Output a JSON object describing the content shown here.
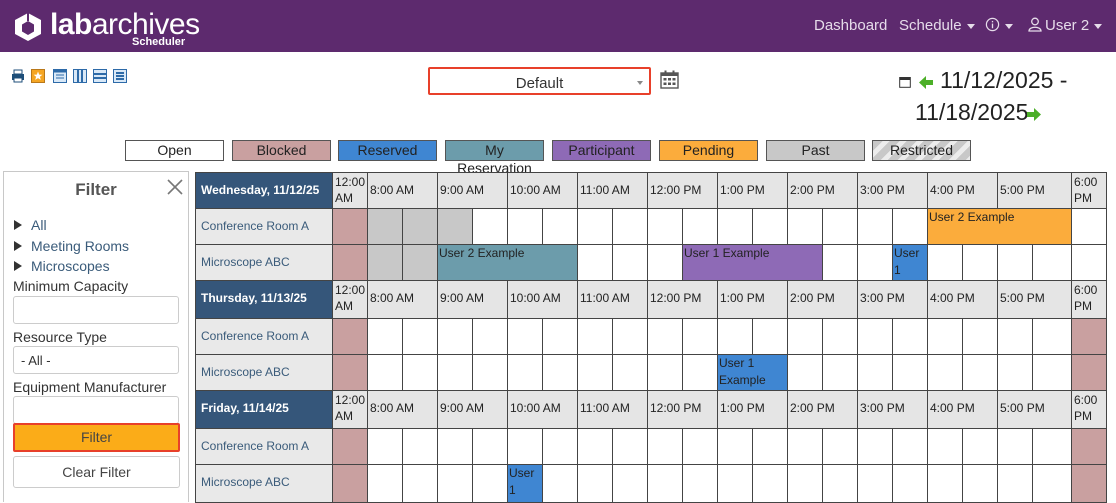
{
  "brand": {
    "name_bold": "lab",
    "name_rest": "archives",
    "subtitle": "Scheduler"
  },
  "nav": {
    "dashboard": "Dashboard",
    "schedule": "Schedule",
    "user": "User 2",
    "icons": [
      "info-icon",
      "user-icon"
    ]
  },
  "toolbar": {
    "icons": [
      "print-icon",
      "favorite-icon",
      "day-view-icon",
      "week-view-icon",
      "month-view-icon",
      "list-view-icon"
    ]
  },
  "view_select": {
    "value": "Default"
  },
  "date_range": {
    "line1": "11/12/2025 -",
    "line2": "11/18/2025"
  },
  "legend": [
    {
      "label": "Open",
      "color": "#ffffff"
    },
    {
      "label": "Blocked",
      "color": "#c9a0a0"
    },
    {
      "label": "Reserved",
      "color": "#3f86d2"
    },
    {
      "label": "My Reservation",
      "color": "#6c9cab"
    },
    {
      "label": "Participant",
      "color": "#8e6ab6"
    },
    {
      "label": "Pending",
      "color": "#fbac3c"
    },
    {
      "label": "Past",
      "color": "#c8c8c8"
    },
    {
      "label": "Restricted",
      "color": "#cfcfcf"
    }
  ],
  "filter": {
    "title": "Filter",
    "tree": [
      "All",
      "Meeting Rooms",
      "Microscopes"
    ],
    "min_capacity_label": "Minimum Capacity",
    "min_capacity_value": "",
    "resource_type_label": "Resource Type",
    "resource_type_value": "- All -",
    "manufacturer_label": "Equipment Manufacturer",
    "manufacturer_value": "",
    "filter_button": "Filter",
    "clear_button": "Clear Filter"
  },
  "times": [
    "12:00 AM",
    "8:00 AM",
    "9:00 AM",
    "10:00 AM",
    "11:00 AM",
    "12:00 PM",
    "1:00 PM",
    "2:00 PM",
    "3:00 PM",
    "4:00 PM",
    "5:00 PM",
    "6:00 PM"
  ],
  "days": [
    {
      "label": "Wednesday, 11/12/25",
      "resources": [
        {
          "name": "Conference Room A",
          "slots": [
            "blocked",
            "past",
            "past",
            "past",
            "",
            "",
            "",
            "",
            "",
            "",
            "",
            "",
            "",
            "",
            "",
            "",
            "",
            "",
            "",
            "",
            "",
            ""
          ]
        },
        {
          "name": "Microscope ABC",
          "slots": [
            "blocked",
            "past",
            "past",
            "past",
            "",
            "",
            "",
            "",
            "",
            "",
            "",
            "",
            "",
            "",
            "",
            "",
            "",
            "",
            "",
            "",
            "",
            ""
          ]
        }
      ]
    },
    {
      "label": "Thursday, 11/13/25",
      "resources": [
        {
          "name": "Conference Room A",
          "slots": [
            "blocked",
            "",
            "",
            "",
            "",
            "",
            "",
            "",
            "",
            "",
            "",
            "",
            "",
            "",
            "",
            "",
            "",
            "",
            "",
            "",
            "",
            "blocked"
          ]
        },
        {
          "name": "Microscope ABC",
          "slots": [
            "blocked",
            "",
            "",
            "",
            "",
            "",
            "",
            "",
            "",
            "",
            "",
            "",
            "",
            "",
            "",
            "",
            "",
            "",
            "",
            "",
            "",
            "blocked"
          ]
        }
      ]
    },
    {
      "label": "Friday, 11/14/25",
      "resources": [
        {
          "name": "Conference Room A",
          "slots": [
            "blocked",
            "",
            "",
            "",
            "",
            "",
            "",
            "",
            "",
            "",
            "",
            "",
            "",
            "",
            "",
            "",
            "",
            "",
            "",
            "",
            "",
            "blocked"
          ]
        },
        {
          "name": "Microscope ABC",
          "slots": [
            "blocked",
            "",
            "",
            "",
            "",
            "",
            "",
            "",
            "",
            "",
            "",
            "",
            "",
            "",
            "",
            "",
            "",
            "",
            "",
            "",
            "",
            "blocked"
          ]
        }
      ]
    }
  ],
  "events": [
    {
      "day": 0,
      "row": 0,
      "start": "4:00 PM",
      "end": "6:00 PM",
      "label": "User 2 Example",
      "status": "Pending"
    },
    {
      "day": 0,
      "row": 1,
      "start": "9:00 AM",
      "end": "11:00 AM",
      "label": "User 2 Example",
      "status": "My Reservation"
    },
    {
      "day": 0,
      "row": 1,
      "start": "12:30 PM",
      "end": "2:30 PM",
      "label": "User 1 Example",
      "status": "Participant"
    },
    {
      "day": 0,
      "row": 1,
      "start": "3:30 PM",
      "end": "4:00 PM",
      "label": "User 1",
      "status": "Reserved"
    },
    {
      "day": 1,
      "row": 1,
      "start": "1:00 PM",
      "end": "2:00 PM",
      "label": "User 1 Example",
      "status": "Reserved"
    },
    {
      "day": 2,
      "row": 1,
      "start": "10:00 AM",
      "end": "10:30 AM",
      "label": "User 1",
      "status": "Reserved"
    }
  ]
}
